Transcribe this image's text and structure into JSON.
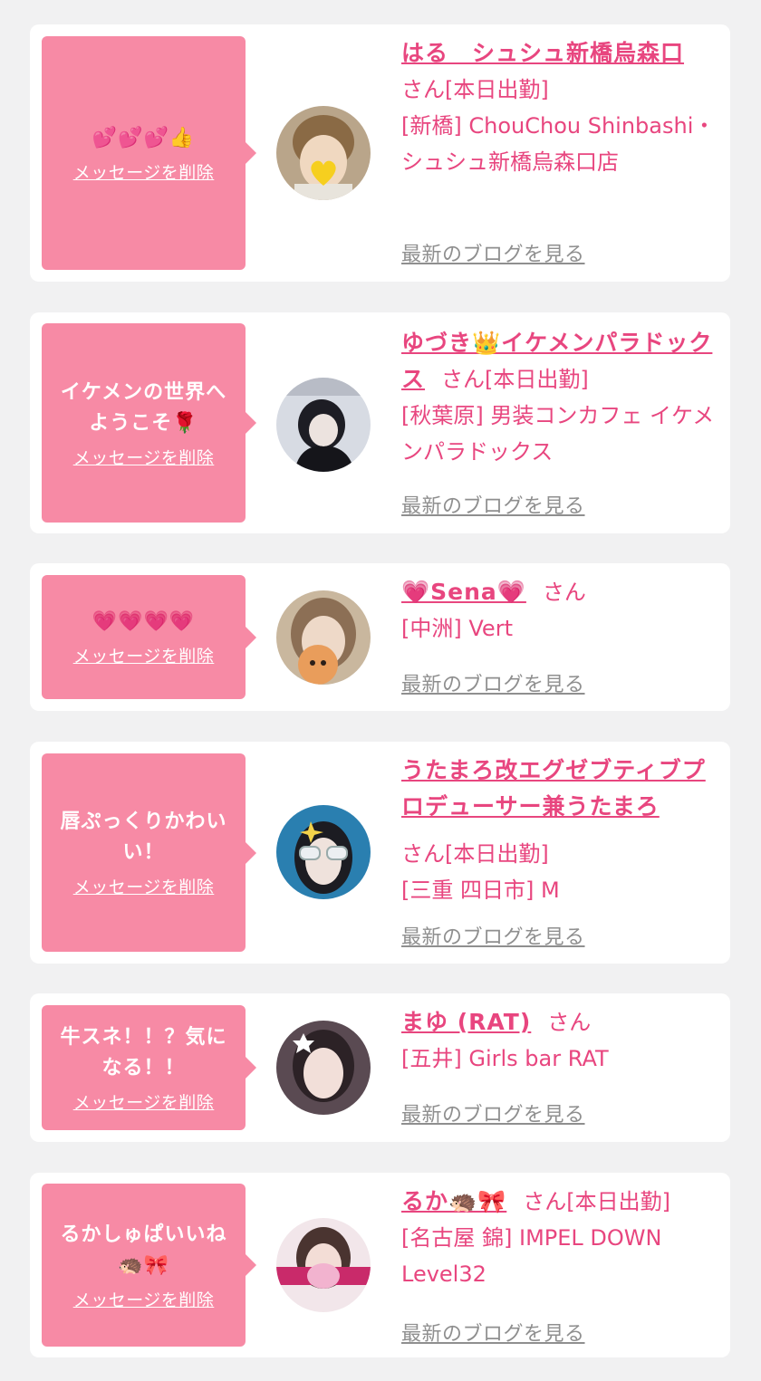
{
  "delete_label": "メッセージを削除",
  "blog_label": "最新のブログを見る",
  "san_label": "さん",
  "today_label": "[本日出勤]",
  "colors": {
    "accent": "#e8467f",
    "bubble": "#f78aa5",
    "muted": "#8f8f8f",
    "background": "#f1f1f2"
  },
  "cards": [
    {
      "message": "💕💕💕👍",
      "name": "はる　シュシュ新橋烏森口",
      "today": "[本日出勤]",
      "area": "[新橋]",
      "shop": "ChouChou Shinbashi・シュシュ新橋烏森口店"
    },
    {
      "message": "イケメンの世界へようこそ🌹",
      "name": "ゆづき👑イケメンパラドックス",
      "today": "[本日出勤]",
      "area": "[秋葉原]",
      "shop": "男装コンカフェ イケメンパラドックス"
    },
    {
      "message": "💗💗💗💗",
      "name": "💗Sena💗",
      "today": "",
      "area": "[中洲]",
      "shop": "Vert"
    },
    {
      "message": "唇ぷっくりかわいい！",
      "name": "うたまろ改エグゼブティブプロデューサー兼うたまろ",
      "today": "[本日出勤]",
      "area": "[三重 四日市]",
      "shop": "M"
    },
    {
      "message": "牛スネ！！？気になる！！",
      "name": "まゆ (RAT)",
      "today": "",
      "area": "[五井]",
      "shop": "Girls bar RAT"
    },
    {
      "message": "るかしゅぱいいね🦔🎀",
      "name": "るか🦔🎀",
      "today": "[本日出勤]",
      "area": "[名古屋 錦]",
      "shop": "IMPEL DOWN Level32"
    }
  ]
}
